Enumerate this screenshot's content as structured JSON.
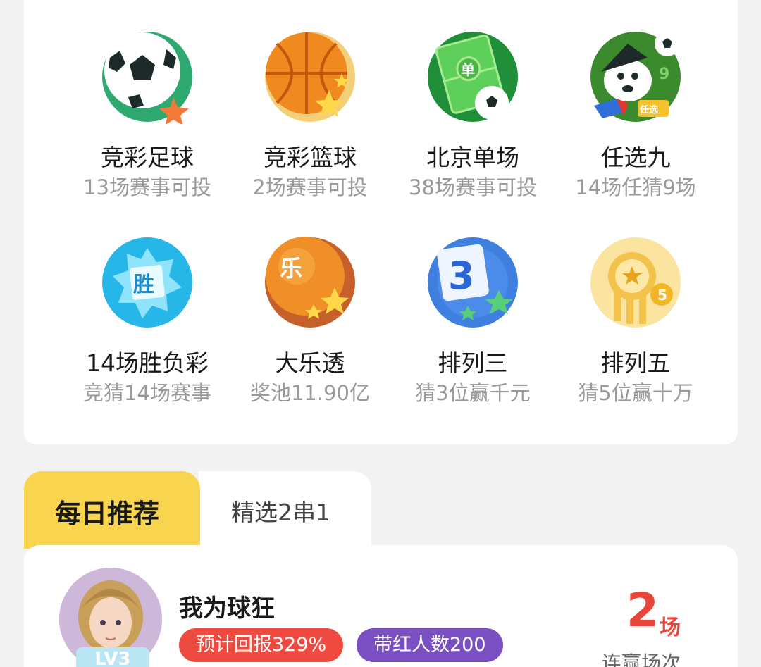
{
  "games": [
    {
      "name": "竞彩足球",
      "sub": "13场赛事可投",
      "icon": "football-star-icon",
      "color": "#2eaa70"
    },
    {
      "name": "竞彩篮球",
      "sub": "2场赛事可投",
      "icon": "basketball-star-icon",
      "color": "#f08a20"
    },
    {
      "name": "北京单场",
      "sub": "38场赛事可投",
      "icon": "pitch-ball-icon",
      "color": "#34b04f"
    },
    {
      "name": "任选九",
      "sub": "14场任猜9场",
      "icon": "mascot-icon",
      "color": "#3b8a2e"
    },
    {
      "name": "14场胜负彩",
      "sub": "竞猜14场赛事",
      "icon": "win-star-icon",
      "color": "#27b6e8"
    },
    {
      "name": "大乐透",
      "sub": "奖池11.90亿",
      "icon": "le-ball-icon",
      "color": "#e8751c"
    },
    {
      "name": "排列三",
      "sub": "猜3位赢千元",
      "icon": "number-three-icon",
      "color": "#3e7fe0"
    },
    {
      "name": "排列五",
      "sub": "猜5位赢十万",
      "icon": "coin-icon",
      "color": "#f3c24a"
    }
  ],
  "icon_text": {
    "pitch": "单",
    "mascot_tag": "任选",
    "mascot_num": "9",
    "win": "胜",
    "le": "乐",
    "three": "3",
    "coin": "5"
  },
  "tabs": {
    "active": "每日推荐",
    "inactive": "精选2串1"
  },
  "recommendation": {
    "name": "我为球狂",
    "level": "LV3",
    "badge_return": "预计回报329%",
    "badge_people": "带红人数200",
    "streak_value": "2",
    "streak_unit": "场",
    "streak_label": "连赢场次"
  }
}
